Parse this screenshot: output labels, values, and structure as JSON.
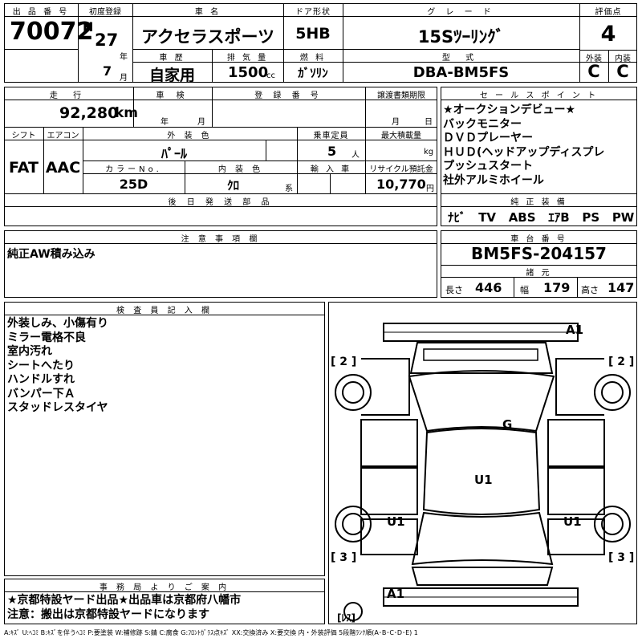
{
  "header": {
    "lot_no_label": "出 品 番 号",
    "lot_no": "70072",
    "first_reg_label": "初度登録",
    "era": "H",
    "year": "27",
    "year_unit": "年",
    "month": "7",
    "month_unit": "月",
    "car_name_label": "車 名",
    "car_name": "アクセラスポーツ",
    "history_label": "車 歴",
    "history": "自家用",
    "displacement_label": "排 気 量",
    "displacement": "1500",
    "displacement_unit": "cc",
    "door_label": "ドア形状",
    "door": "5HB",
    "fuel_label": "燃 料",
    "fuel": "ｶﾞｿﾘﾝ",
    "grade_label": "グ レ ー ド",
    "grade": "15Sﾂｰﾘﾝｸﾞ",
    "model_label": "型 式",
    "model": "DBA-BM5FS",
    "score_label": "評価点",
    "score": "4",
    "exterior_label": "外装",
    "exterior": "C",
    "interior_label": "内装",
    "interior": "C"
  },
  "details": {
    "mileage_label": "走 行",
    "mileage": "92,280",
    "mileage_unit": "km",
    "inspection_label": "車 検",
    "inspection_year_unit": "年",
    "inspection_month_unit": "月",
    "plate_label": "登 録 番 号",
    "transfer_label": "譲渡書類期限",
    "transfer_month_unit": "月",
    "transfer_day_unit": "日",
    "shift_label": "シフト",
    "shift": "FAT",
    "ac_label": "エアコン",
    "ac": "AAC",
    "ext_color_label": "外 装 色",
    "ext_color": "ﾊﾟｰﾙ",
    "capacity_label": "乗車定員",
    "capacity": "5",
    "capacity_unit": "人",
    "load_label": "最大積載量",
    "load_unit": "kg",
    "color_no_label": "カラーNo.",
    "color_no": "25D",
    "int_color_label": "内 装 色",
    "int_color": "ｸﾛ",
    "int_color_unit": "系",
    "import_label": "輸 入 車",
    "recycle_label": "リサイクル預託金",
    "recycle": "10,770",
    "recycle_unit": "円",
    "later_parts_label": "後 日 発 送 部 品"
  },
  "sales_points": {
    "label": "セ ー ル ス ポ イ ン ト",
    "lines": [
      "★オークションデビュー★",
      "バックモニター",
      "ＤＶＤプレーヤー",
      "ＨＵＤ(ヘッドアップディスプレ",
      "プッシュスタート",
      "社外アルミホイール"
    ]
  },
  "equipment": {
    "label": "純 正 装 備",
    "items": [
      "ﾅﾋﾞ",
      "TV",
      "ABS",
      "ｴｱB",
      "PS",
      "PW"
    ]
  },
  "caution": {
    "label": "注 意 事 項 欄",
    "text": "純正AW積み込み"
  },
  "chassis": {
    "label": "車 台 番 号",
    "number": "BM5FS-204157",
    "specs_label": "諸 元",
    "length_label": "長さ",
    "length": "446",
    "width_label": "幅",
    "width": "179",
    "height_label": "高さ",
    "height": "147"
  },
  "inspector": {
    "label": "検 査 員 記 入 欄",
    "lines": [
      "外装しみ、小傷有り",
      "ミラー電格不良",
      "室内汚れ",
      "シートへたり",
      "ハンドルすれ",
      "バンパー下Ａ",
      "スタッドレスタイヤ"
    ]
  },
  "office": {
    "label": "事 務 局 よ り ご 案 内",
    "lines": [
      "★京都特設ヤード出品★出品車は京都府八幡市",
      "注意：搬出は京都特設ヤードになります"
    ]
  },
  "diagram": {
    "marks": [
      "A1",
      "G",
      "U1",
      "U1",
      "U1",
      "A1"
    ],
    "tire_labels": [
      "[ 2 ]",
      "[ 2 ]",
      "[ 3 ]",
      "[ 3 ]",
      "[ﾚｽ]"
    ]
  },
  "legend": "A:ｷｽﾞ U:ﾍｺﾐ B:ｷｽﾞを伴うﾍｺﾐ P:要塗装 W:補修跡 S:錆 C:腐食 G:ﾌﾛﾝﾄｶﾞﾗｽ点ｷｽﾞ XX:交換済み X:要交換 内・外装評価 5段階ﾗﾝｸ順(A･B･C･D･E) 1"
}
